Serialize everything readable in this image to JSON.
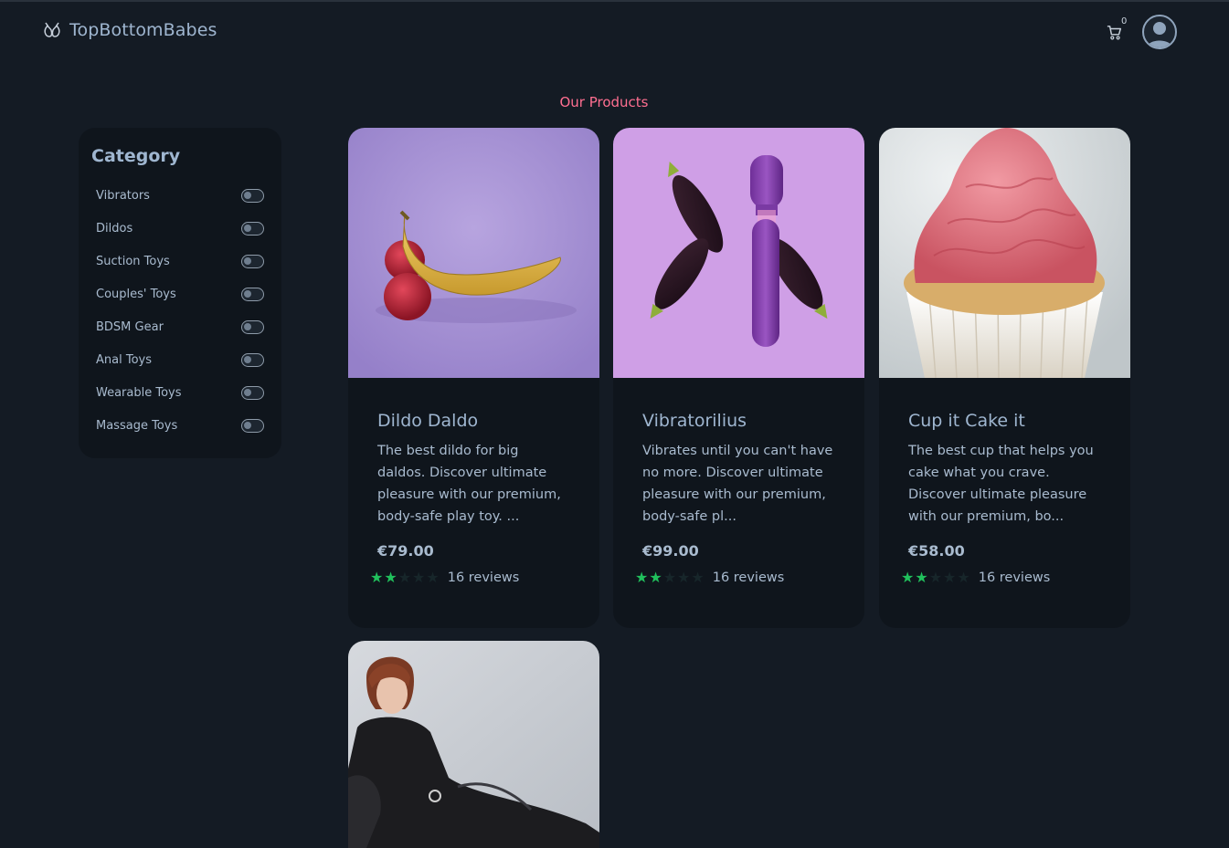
{
  "header": {
    "brand": "TopBottomBabes",
    "cart_count": "0"
  },
  "section_title": "Our Products",
  "sidebar": {
    "title": "Category",
    "items": [
      {
        "label": "Vibrators"
      },
      {
        "label": "Dildos"
      },
      {
        "label": "Suction Toys"
      },
      {
        "label": "Couples' Toys"
      },
      {
        "label": "BDSM Gear"
      },
      {
        "label": "Anal Toys"
      },
      {
        "label": "Wearable Toys"
      },
      {
        "label": "Massage Toys"
      }
    ]
  },
  "products": [
    {
      "title": "Dildo Daldo",
      "description": "The best dildo for big daldos. Discover ultimate pleasure with our premium, body-safe play toy. ...",
      "price": "€79.00",
      "rating": 2,
      "reviews": "16 reviews",
      "image": "banana-and-peaches-photo"
    },
    {
      "title": "Vibratorilius",
      "description": "Vibrates until you can't have no more. Discover ultimate pleasure with our premium, body-safe pl...",
      "price": "€99.00",
      "rating": 2,
      "reviews": "16 reviews",
      "image": "eggplants-and-wand-photo"
    },
    {
      "title": "Cup it Cake it",
      "description": "The best cup that helps you cake what you crave. Discover ultimate pleasure with our premium, bo...",
      "price": "€58.00",
      "rating": 2,
      "reviews": "16 reviews",
      "image": "cupcake-photo"
    },
    {
      "image": "woman-in-latex-suit-photo"
    }
  ],
  "colors": {
    "background": "#141b24",
    "card": "#0f151c",
    "accent": "#ff6f91",
    "star": "#20c05c"
  }
}
